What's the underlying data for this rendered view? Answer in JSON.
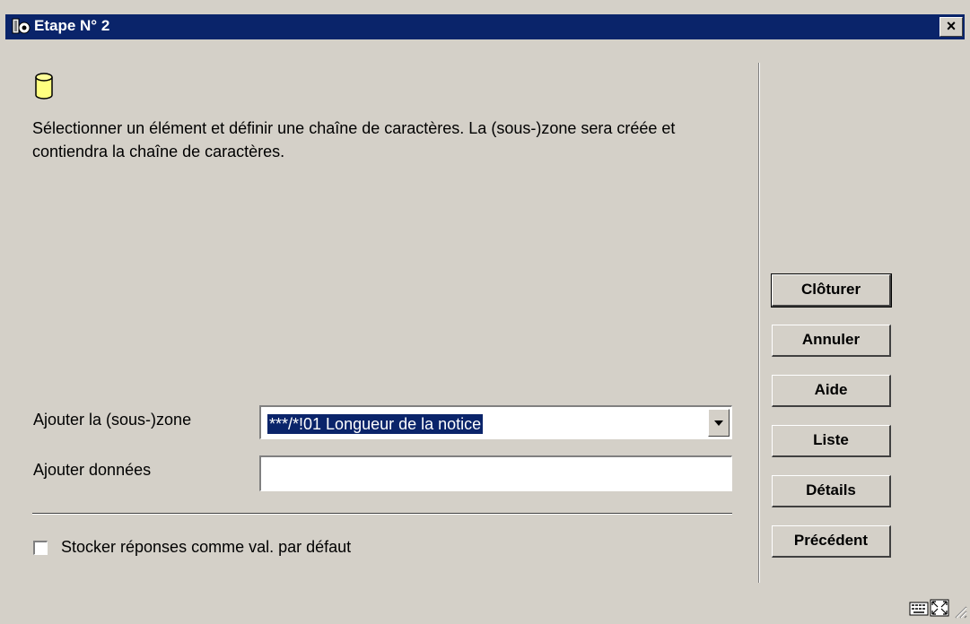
{
  "window": {
    "title": "Etape N° 2",
    "close_label": "×"
  },
  "content": {
    "instructions": "Sélectionner un élément et définir une chaîne de caractères. La (sous-)zone sera créée et contiendra la chaîne de caractères."
  },
  "form": {
    "zone_label": "Ajouter la (sous-)zone",
    "zone_value": "***/*!01 Longueur de la notice",
    "data_label": "Ajouter données",
    "data_value": "",
    "checkbox_label": "Stocker réponses comme val. par défaut",
    "checkbox_checked": false
  },
  "buttons": {
    "close": "Clôturer",
    "cancel": "Annuler",
    "help": "Aide",
    "list": "Liste",
    "details": "Détails",
    "previous": "Précédent"
  },
  "icons": {
    "title": "app-icon",
    "database": "database-icon",
    "keyboard": "keyboard-icon",
    "fullscreen": "fullscreen-icon",
    "resize": "resize-grip-icon"
  },
  "colors": {
    "titlebar": "#0a246a",
    "face": "#d4d0c8",
    "selection": "#0a246a"
  }
}
